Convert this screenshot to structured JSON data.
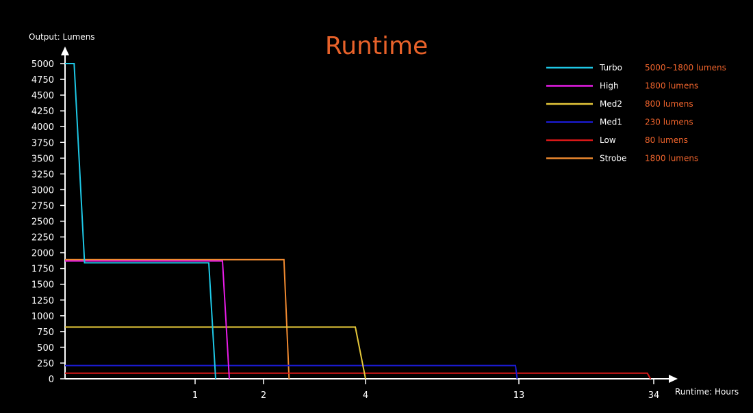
{
  "chart_data": {
    "type": "line",
    "title": "Runtime",
    "ylabel": "Output: Lumens",
    "xlabel": "Runtime: Hours",
    "ylim": [
      0,
      5000
    ],
    "y_ticks": [
      0,
      250,
      500,
      750,
      1000,
      1250,
      1500,
      1750,
      2000,
      2250,
      2500,
      2750,
      3000,
      3250,
      3500,
      3750,
      4000,
      4250,
      4500,
      4750,
      5000
    ],
    "x_scale": "non-linear (labeled ticks only)",
    "x_ticks": [
      "1",
      "2",
      "4",
      "13",
      "34"
    ],
    "grid": false,
    "legend_position": "top-right",
    "series": [
      {
        "name": "Turbo",
        "description": "5000~1800 lumens",
        "color": "#1ec8e6",
        "points": [
          [
            0,
            5000
          ],
          [
            0.07,
            5000
          ],
          [
            0.15,
            1840
          ],
          [
            1.2,
            1840
          ],
          [
            1.3,
            0
          ]
        ]
      },
      {
        "name": "High",
        "description": "1800 lumens",
        "color": "#e81ce8",
        "points": [
          [
            0,
            1870
          ],
          [
            1.4,
            1870
          ],
          [
            1.5,
            0
          ]
        ]
      },
      {
        "name": "Med2",
        "description": "800 lumens",
        "color": "#e6c83a",
        "points": [
          [
            0,
            820
          ],
          [
            3.8,
            820
          ],
          [
            4.0,
            0
          ]
        ]
      },
      {
        "name": "Med1",
        "description": "230 lumens",
        "color": "#1a1ad0",
        "points": [
          [
            0,
            210
          ],
          [
            12.8,
            210
          ],
          [
            12.9,
            0
          ]
        ]
      },
      {
        "name": "Low",
        "description": "80 lumens",
        "color": "#d81818",
        "points": [
          [
            0,
            90
          ],
          [
            33,
            90
          ],
          [
            33.5,
            0
          ]
        ]
      },
      {
        "name": "Strobe",
        "description": "1800 lumens",
        "color": "#f08a30",
        "points": [
          [
            0,
            1890
          ],
          [
            2.4,
            1890
          ],
          [
            2.5,
            0
          ]
        ]
      }
    ]
  }
}
